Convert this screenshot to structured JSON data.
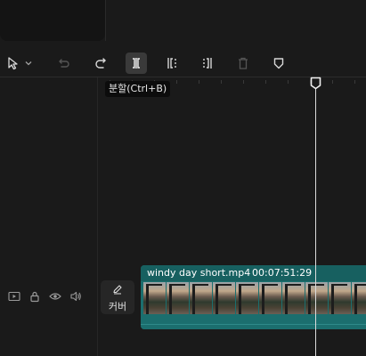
{
  "toolbar": {
    "tools": [
      {
        "name": "select-tool",
        "icon": "cursor-arrow-icon"
      },
      {
        "name": "select-dropdown",
        "icon": "chevron-down-icon"
      },
      {
        "name": "undo-button",
        "icon": "undo-icon"
      },
      {
        "name": "redo-button",
        "icon": "redo-icon"
      },
      {
        "name": "split-button",
        "icon": "split-icon"
      },
      {
        "name": "trim-left-button",
        "icon": "trim-left-icon"
      },
      {
        "name": "trim-right-button",
        "icon": "trim-right-icon"
      },
      {
        "name": "delete-button",
        "icon": "trash-icon"
      },
      {
        "name": "marker-button",
        "icon": "shield-marker-icon"
      }
    ]
  },
  "tooltip": {
    "text": "분할(Ctrl+B)"
  },
  "track": {
    "cover_label": "커버",
    "controls": [
      "video-track-icon",
      "lock-icon",
      "eye-icon",
      "audio-icon"
    ]
  },
  "clip": {
    "name": "windy day short.mp4",
    "duration": "00:07:51:29"
  },
  "colors": {
    "clip_bg": "#1b6e6e",
    "playhead": "#dcdcdc",
    "background": "#1a1a1a"
  }
}
